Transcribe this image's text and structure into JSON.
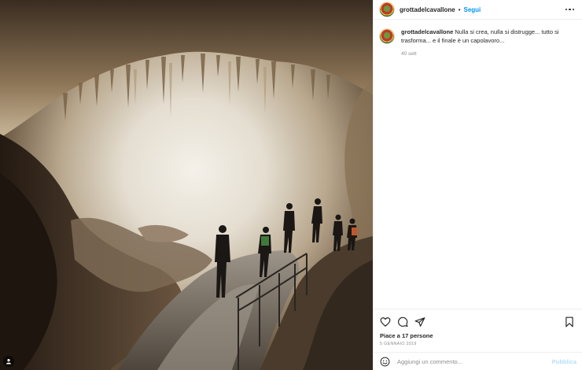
{
  "post": {
    "image_alt": "",
    "username": "grottadelcavallone",
    "separator": "•",
    "follow_label": "Segui"
  },
  "caption": {
    "username": "grottadelcavallone",
    "text": "Nulla si crea, nulla si distrugge... tutto si trasforma... e il finale è un capolavoro...",
    "time_ago": "40 sett"
  },
  "actions": {
    "like_icon": "heart-icon",
    "comment_icon": "comment-icon",
    "share_icon": "share-icon",
    "save_icon": "bookmark-icon",
    "likes": "Piace a 17 persone",
    "date": "5 GENNAIO 2019"
  },
  "comment": {
    "emoji_icon": "emoji-icon",
    "placeholder": "Aggiungi un commento...",
    "publish_label": "Pubblica"
  },
  "colors": {
    "accent": "#0095f6",
    "publish_disabled": "#b2dffc",
    "secondary_text": "#8e8e8e"
  }
}
